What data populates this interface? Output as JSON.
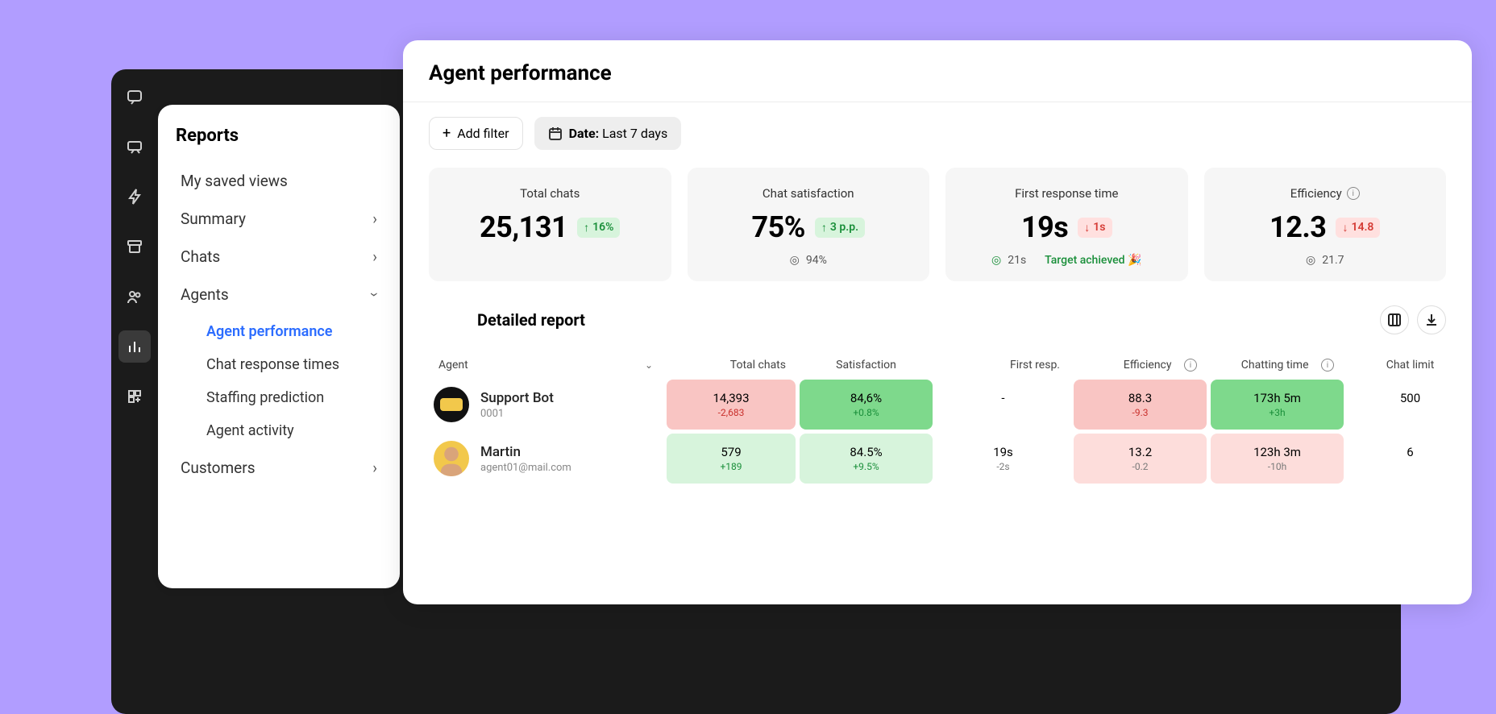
{
  "icons": {
    "chat": "chat-icon",
    "helpdesk": "helpdesk-icon",
    "automation": "automation-icon",
    "archive": "archive-icon",
    "people": "people-icon",
    "reports": "reports-icon",
    "apps": "apps-icon"
  },
  "sidebar": {
    "title": "Reports",
    "items": [
      {
        "label": "My saved views",
        "expandable": false
      },
      {
        "label": "Summary",
        "expandable": true
      },
      {
        "label": "Chats",
        "expandable": true
      },
      {
        "label": "Agents",
        "expandable": true,
        "expanded": true,
        "children": [
          {
            "label": "Agent performance",
            "active": true
          },
          {
            "label": "Chat response times"
          },
          {
            "label": "Staffing prediction"
          },
          {
            "label": "Agent activity"
          }
        ]
      },
      {
        "label": "Customers",
        "expandable": true
      }
    ]
  },
  "main": {
    "title": "Agent performance",
    "filters": {
      "add_label": "Add filter",
      "date_prefix": "Date:",
      "date_value": "Last 7 days"
    },
    "cards": [
      {
        "title": "Total chats",
        "value": "25,131",
        "delta": "16%",
        "dir": "up",
        "sub": ""
      },
      {
        "title": "Chat satisfaction",
        "value": "75%",
        "delta": "3 p.p.",
        "dir": "up",
        "sub": "94%"
      },
      {
        "title": "First response time",
        "value": "19s",
        "delta": "1s",
        "dir": "down",
        "sub": "21s",
        "extra": "Target achieved 🎉"
      },
      {
        "title": "Efficiency",
        "value": "12.3",
        "delta": "14.8",
        "dir": "down",
        "sub": "21.7",
        "info": true
      }
    ],
    "detailed_title": "Detailed report",
    "columns": {
      "agent": "Agent",
      "total": "Total chats",
      "sat": "Satisfaction",
      "first": "First resp.",
      "eff": "Efficiency",
      "chat_time": "Chatting time",
      "limit": "Chat limit"
    },
    "rows": [
      {
        "name": "Support Bot",
        "subtitle": "0001",
        "avatar": "bot",
        "total": {
          "v": "14,393",
          "sub": "-2,683",
          "sign": "neg",
          "bg": "red-light"
        },
        "sat": {
          "v": "84,6%",
          "sub": "+0.8%",
          "sign": "pos",
          "bg": "green"
        },
        "first": {
          "v": "-",
          "sub": "",
          "sign": "",
          "bg": "none"
        },
        "eff": {
          "v": "88.3",
          "sub": "-9.3",
          "sign": "neg",
          "bg": "red-light"
        },
        "time": {
          "v": "173h 5m",
          "sub": "+3h",
          "sign": "pos",
          "bg": "green"
        },
        "limit": {
          "v": "500",
          "bg": "none"
        }
      },
      {
        "name": "Martin",
        "subtitle": "agent01@mail.com",
        "avatar": "person",
        "total": {
          "v": "579",
          "sub": "+189",
          "sign": "pos",
          "bg": "green-pale"
        },
        "sat": {
          "v": "84.5%",
          "sub": "+9.5%",
          "sign": "pos",
          "bg": "green-pale"
        },
        "first": {
          "v": "19s",
          "sub": "-2s",
          "sign": "muted",
          "bg": "none"
        },
        "eff": {
          "v": "13.2",
          "sub": "-0.2",
          "sign": "muted",
          "bg": "red-lighter"
        },
        "time": {
          "v": "123h 3m",
          "sub": "-10h",
          "sign": "muted",
          "bg": "red-lighter"
        },
        "limit": {
          "v": "6",
          "bg": "none"
        }
      }
    ]
  }
}
